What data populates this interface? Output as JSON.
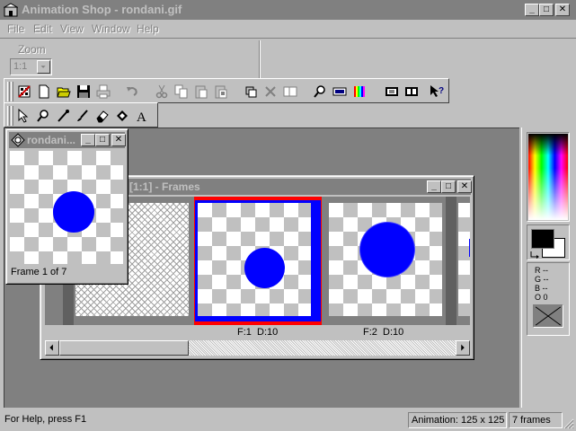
{
  "window": {
    "title": "Animation Shop - rondani.gif"
  },
  "menu": [
    "File",
    "Edit",
    "View",
    "Window",
    "Help"
  ],
  "zoom": {
    "label": "Zoom",
    "value": "1:1"
  },
  "toolbar_main": {
    "icons": [
      "new-animation-wizard-icon",
      "new-icon",
      "open-icon",
      "save-icon",
      "print-icon",
      "undo-icon",
      "cut-icon",
      "copy-icon",
      "paste-icon",
      "paste-special-icon",
      "crop-icon",
      "delete-icon",
      "insert-frame-icon",
      "zoom-icon",
      "frame-properties-icon",
      "color-palette-icon",
      "view-animation-icon",
      "view-frames-icon",
      "context-help-icon"
    ]
  },
  "toolbar_tools": {
    "icons": [
      "arrow-tool-icon",
      "zoom-tool-icon",
      "dropper-tool-icon",
      "paintbrush-tool-icon",
      "eraser-tool-icon",
      "fill-tool-icon",
      "text-tool-icon"
    ]
  },
  "preview_window": {
    "title": "rondani...",
    "frame_label": "Frame 1 of 7"
  },
  "frames_window": {
    "title": "[1:1] - Frames",
    "frames": [
      {
        "label": "F:1  D:10"
      },
      {
        "label": "F:2  D:10"
      }
    ]
  },
  "color_panel": {
    "r": "R --",
    "g": "G --",
    "b": "B --",
    "o": "O 0"
  },
  "status": {
    "help": "For Help, press F1",
    "animation": "Animation: 125 x 125",
    "frames": "7 frames"
  },
  "colors": {
    "dot": "#0000ff",
    "selected_border_outer": "#ff0000",
    "selected_border_inner": "#0000ff",
    "face": "#c0c0c0",
    "workspace": "#808080"
  }
}
